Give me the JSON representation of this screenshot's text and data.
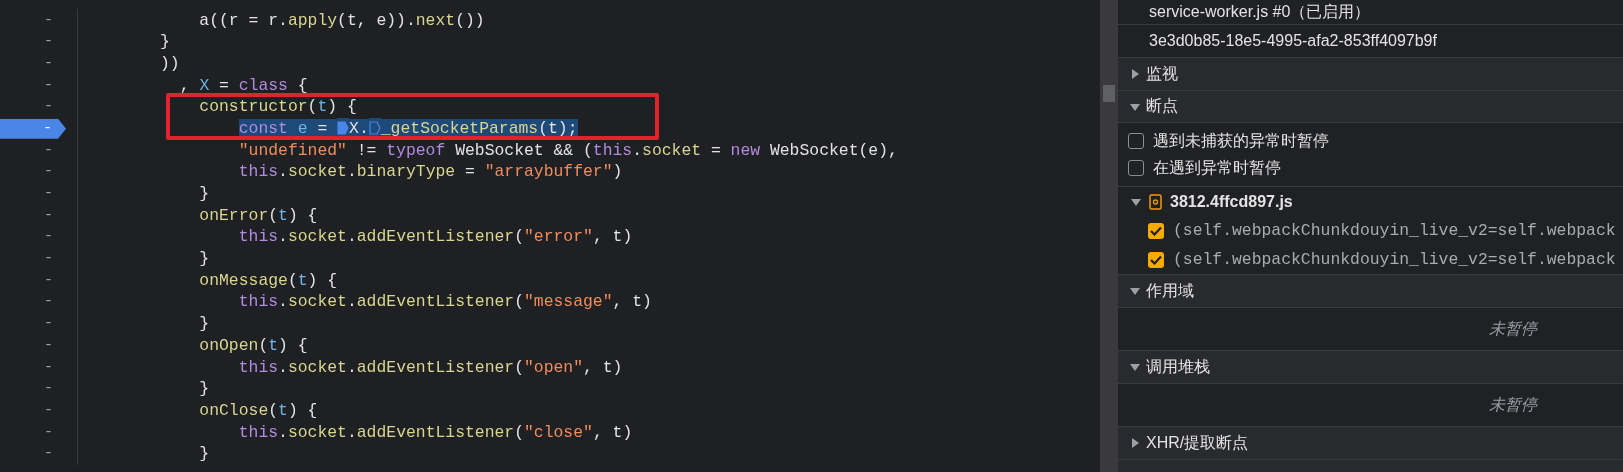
{
  "code": {
    "lines": [
      {
        "gutter": "-",
        "breakpoint": false,
        "selected": false,
        "tokens": [
          {
            "kind": "plain",
            "text": "    a((r = r."
          },
          {
            "kind": "fn",
            "text": "apply"
          },
          {
            "kind": "plain",
            "text": "(t, e))."
          },
          {
            "kind": "fn",
            "text": "next"
          },
          {
            "kind": "plain",
            "text": "())"
          }
        ]
      },
      {
        "gutter": "-",
        "breakpoint": false,
        "selected": false,
        "tokens": [
          {
            "kind": "plain",
            "text": "}"
          }
        ]
      },
      {
        "gutter": "-",
        "breakpoint": false,
        "selected": false,
        "tokens": [
          {
            "kind": "plain",
            "text": "))"
          }
        ]
      },
      {
        "gutter": "-",
        "breakpoint": false,
        "selected": false,
        "tokens": [
          {
            "kind": "plain",
            "text": "  , "
          },
          {
            "kind": "param",
            "text": "X"
          },
          {
            "kind": "plain",
            "text": " = "
          },
          {
            "kind": "keyword",
            "text": "class"
          },
          {
            "kind": "plain",
            "text": " {"
          }
        ]
      },
      {
        "gutter": "-",
        "breakpoint": false,
        "selected": false,
        "tokens": [
          {
            "kind": "fn",
            "text": "    constructor"
          },
          {
            "kind": "plain",
            "text": "("
          },
          {
            "kind": "param",
            "text": "t"
          },
          {
            "kind": "plain",
            "text": ") {"
          }
        ]
      },
      {
        "gutter": "-",
        "breakpoint": true,
        "selected": true,
        "tokens": [
          {
            "kind": "keyword",
            "text": "        const "
          },
          {
            "kind": "param",
            "text": "e"
          },
          {
            "kind": "plain",
            "text": " = "
          },
          {
            "kind": "marker",
            "active": true
          },
          {
            "kind": "plain",
            "text": "X."
          },
          {
            "kind": "marker",
            "active": false
          },
          {
            "kind": "fn",
            "text": "_getSocketParams"
          },
          {
            "kind": "plain",
            "text": "(t);"
          }
        ]
      },
      {
        "gutter": "-",
        "breakpoint": false,
        "selected": false,
        "tokens": [
          {
            "kind": "string",
            "text": "        \"undefined\""
          },
          {
            "kind": "plain",
            "text": " != "
          },
          {
            "kind": "keyword",
            "text": "typeof"
          },
          {
            "kind": "plain",
            "text": " WebSocket && ("
          },
          {
            "kind": "keyword",
            "text": "this"
          },
          {
            "kind": "plain",
            "text": "."
          },
          {
            "kind": "fn",
            "text": "socket"
          },
          {
            "kind": "plain",
            "text": " = "
          },
          {
            "kind": "keyword",
            "text": "new"
          },
          {
            "kind": "plain",
            "text": " WebSocket(e),"
          }
        ]
      },
      {
        "gutter": "-",
        "breakpoint": false,
        "selected": false,
        "tokens": [
          {
            "kind": "keyword",
            "text": "        this"
          },
          {
            "kind": "plain",
            "text": "."
          },
          {
            "kind": "fn",
            "text": "socket"
          },
          {
            "kind": "plain",
            "text": "."
          },
          {
            "kind": "fn",
            "text": "binaryType"
          },
          {
            "kind": "plain",
            "text": " = "
          },
          {
            "kind": "string",
            "text": "\"arraybuffer\""
          },
          {
            "kind": "plain",
            "text": ")"
          }
        ]
      },
      {
        "gutter": "-",
        "breakpoint": false,
        "selected": false,
        "tokens": [
          {
            "kind": "plain",
            "text": "    }"
          }
        ]
      },
      {
        "gutter": "-",
        "breakpoint": false,
        "selected": false,
        "tokens": [
          {
            "kind": "fn",
            "text": "    onError"
          },
          {
            "kind": "plain",
            "text": "("
          },
          {
            "kind": "param",
            "text": "t"
          },
          {
            "kind": "plain",
            "text": ") {"
          }
        ]
      },
      {
        "gutter": "-",
        "breakpoint": false,
        "selected": false,
        "tokens": [
          {
            "kind": "keyword",
            "text": "        this"
          },
          {
            "kind": "plain",
            "text": "."
          },
          {
            "kind": "fn",
            "text": "socket"
          },
          {
            "kind": "plain",
            "text": "."
          },
          {
            "kind": "fn",
            "text": "addEventListener"
          },
          {
            "kind": "plain",
            "text": "("
          },
          {
            "kind": "string",
            "text": "\"error\""
          },
          {
            "kind": "plain",
            "text": ", t)"
          }
        ]
      },
      {
        "gutter": "-",
        "breakpoint": false,
        "selected": false,
        "tokens": [
          {
            "kind": "plain",
            "text": "    }"
          }
        ]
      },
      {
        "gutter": "-",
        "breakpoint": false,
        "selected": false,
        "tokens": [
          {
            "kind": "fn",
            "text": "    onMessage"
          },
          {
            "kind": "plain",
            "text": "("
          },
          {
            "kind": "param",
            "text": "t"
          },
          {
            "kind": "plain",
            "text": ") {"
          }
        ]
      },
      {
        "gutter": "-",
        "breakpoint": false,
        "selected": false,
        "tokens": [
          {
            "kind": "keyword",
            "text": "        this"
          },
          {
            "kind": "plain",
            "text": "."
          },
          {
            "kind": "fn",
            "text": "socket"
          },
          {
            "kind": "plain",
            "text": "."
          },
          {
            "kind": "fn",
            "text": "addEventListener"
          },
          {
            "kind": "plain",
            "text": "("
          },
          {
            "kind": "string",
            "text": "\"message\""
          },
          {
            "kind": "plain",
            "text": ", t)"
          }
        ]
      },
      {
        "gutter": "-",
        "breakpoint": false,
        "selected": false,
        "tokens": [
          {
            "kind": "plain",
            "text": "    }"
          }
        ]
      },
      {
        "gutter": "-",
        "breakpoint": false,
        "selected": false,
        "tokens": [
          {
            "kind": "fn",
            "text": "    onOpen"
          },
          {
            "kind": "plain",
            "text": "("
          },
          {
            "kind": "param",
            "text": "t"
          },
          {
            "kind": "plain",
            "text": ") {"
          }
        ]
      },
      {
        "gutter": "-",
        "breakpoint": false,
        "selected": false,
        "tokens": [
          {
            "kind": "keyword",
            "text": "        this"
          },
          {
            "kind": "plain",
            "text": "."
          },
          {
            "kind": "fn",
            "text": "socket"
          },
          {
            "kind": "plain",
            "text": "."
          },
          {
            "kind": "fn",
            "text": "addEventListener"
          },
          {
            "kind": "plain",
            "text": "("
          },
          {
            "kind": "string",
            "text": "\"open\""
          },
          {
            "kind": "plain",
            "text": ", t)"
          }
        ]
      },
      {
        "gutter": "-",
        "breakpoint": false,
        "selected": false,
        "tokens": [
          {
            "kind": "plain",
            "text": "    }"
          }
        ]
      },
      {
        "gutter": "-",
        "breakpoint": false,
        "selected": false,
        "tokens": [
          {
            "kind": "fn",
            "text": "    onClose"
          },
          {
            "kind": "plain",
            "text": "("
          },
          {
            "kind": "param",
            "text": "t"
          },
          {
            "kind": "plain",
            "text": ") {"
          }
        ]
      },
      {
        "gutter": "-",
        "breakpoint": false,
        "selected": false,
        "tokens": [
          {
            "kind": "keyword",
            "text": "        this"
          },
          {
            "kind": "plain",
            "text": "."
          },
          {
            "kind": "fn",
            "text": "socket"
          },
          {
            "kind": "plain",
            "text": "."
          },
          {
            "kind": "fn",
            "text": "addEventListener"
          },
          {
            "kind": "plain",
            "text": "("
          },
          {
            "kind": "string",
            "text": "\"close\""
          },
          {
            "kind": "plain",
            "text": ", t)"
          }
        ]
      },
      {
        "gutter": "-",
        "breakpoint": false,
        "selected": false,
        "tokens": [
          {
            "kind": "plain",
            "text": "    }"
          }
        ]
      }
    ]
  },
  "sidebar": {
    "context": [
      "service-worker.js #0（已启用）",
      "3e3d0b85-18e5-4995-afa2-853ff4097b9f"
    ],
    "sections": [
      {
        "title": "监视",
        "expanded": false
      },
      {
        "title": "断点",
        "expanded": true,
        "options": [
          {
            "label": "遇到未捕获的异常时暂停",
            "checked": false
          },
          {
            "label": "在遇到异常时暂停",
            "checked": false
          }
        ],
        "files": [
          {
            "name": "3812.4ffcd897.js",
            "expanded": true,
            "breakpoints": [
              {
                "code": "(self.webpackChunkdouyin_live_v2=self.webpack",
                "checked": true
              },
              {
                "code": "(self.webpackChunkdouyin_live_v2=self.webpack",
                "checked": true
              }
            ]
          }
        ]
      },
      {
        "title": "作用域",
        "expanded": true,
        "message": "未暂停"
      },
      {
        "title": "调用堆栈",
        "expanded": true,
        "message": "未暂停"
      },
      {
        "title": "XHR/提取断点",
        "expanded": false
      }
    ]
  }
}
